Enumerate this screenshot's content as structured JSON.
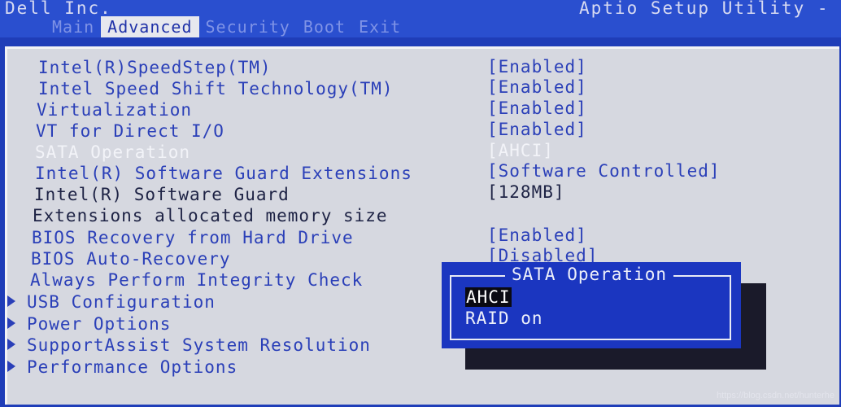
{
  "header": {
    "vendor": "Dell Inc.",
    "utility_title": "Aptio Setup Utility - A",
    "tabs": [
      {
        "label": "Main",
        "active": false
      },
      {
        "label": "Advanced",
        "active": true
      },
      {
        "label": "Security",
        "active": false
      },
      {
        "label": "Boot",
        "active": false
      },
      {
        "label": "Exit",
        "active": false
      }
    ]
  },
  "settings": [
    {
      "label": "Intel(R)SpeedStep(TM)",
      "value": "[Enabled]"
    },
    {
      "label": "Intel Speed Shift Technology(TM)",
      "value": "[Enabled]"
    },
    {
      "label": "Virtualization",
      "value": "[Enabled]"
    },
    {
      "label": "VT for Direct I/O",
      "value": "[Enabled]"
    },
    {
      "label": "SATA Operation",
      "value": "[AHCI]"
    },
    {
      "label": "Intel(R) Software Guard Extensions",
      "value": "[Software Controlled]"
    },
    {
      "label": "Intel(R) Software Guard",
      "value": "[128MB]"
    },
    {
      "label": "Extensions allocated memory size",
      "value": ""
    },
    {
      "label": "BIOS Recovery from Hard Drive",
      "value": "[Enabled]"
    },
    {
      "label": "BIOS Auto-Recovery",
      "value": "[Disabled]"
    },
    {
      "label": "Always Perform Integrity Check",
      "value": ""
    }
  ],
  "submenus": [
    {
      "label": "USB Configuration"
    },
    {
      "label": "Power Options"
    },
    {
      "label": "SupportAssist System Resolution"
    },
    {
      "label": "Performance Options"
    }
  ],
  "popup": {
    "title": "SATA Operation",
    "options": [
      {
        "label": "AHCI",
        "selected": true
      },
      {
        "label": "RAID on",
        "selected": false
      }
    ]
  },
  "watermark": "https://blog.csdn.net/hunterhe",
  "colors": {
    "background_blue": "#1f3db8",
    "panel_gray": "#d6d8e0",
    "item_blue": "#2a3fb8",
    "highlight_white": "#f2f3f8"
  }
}
